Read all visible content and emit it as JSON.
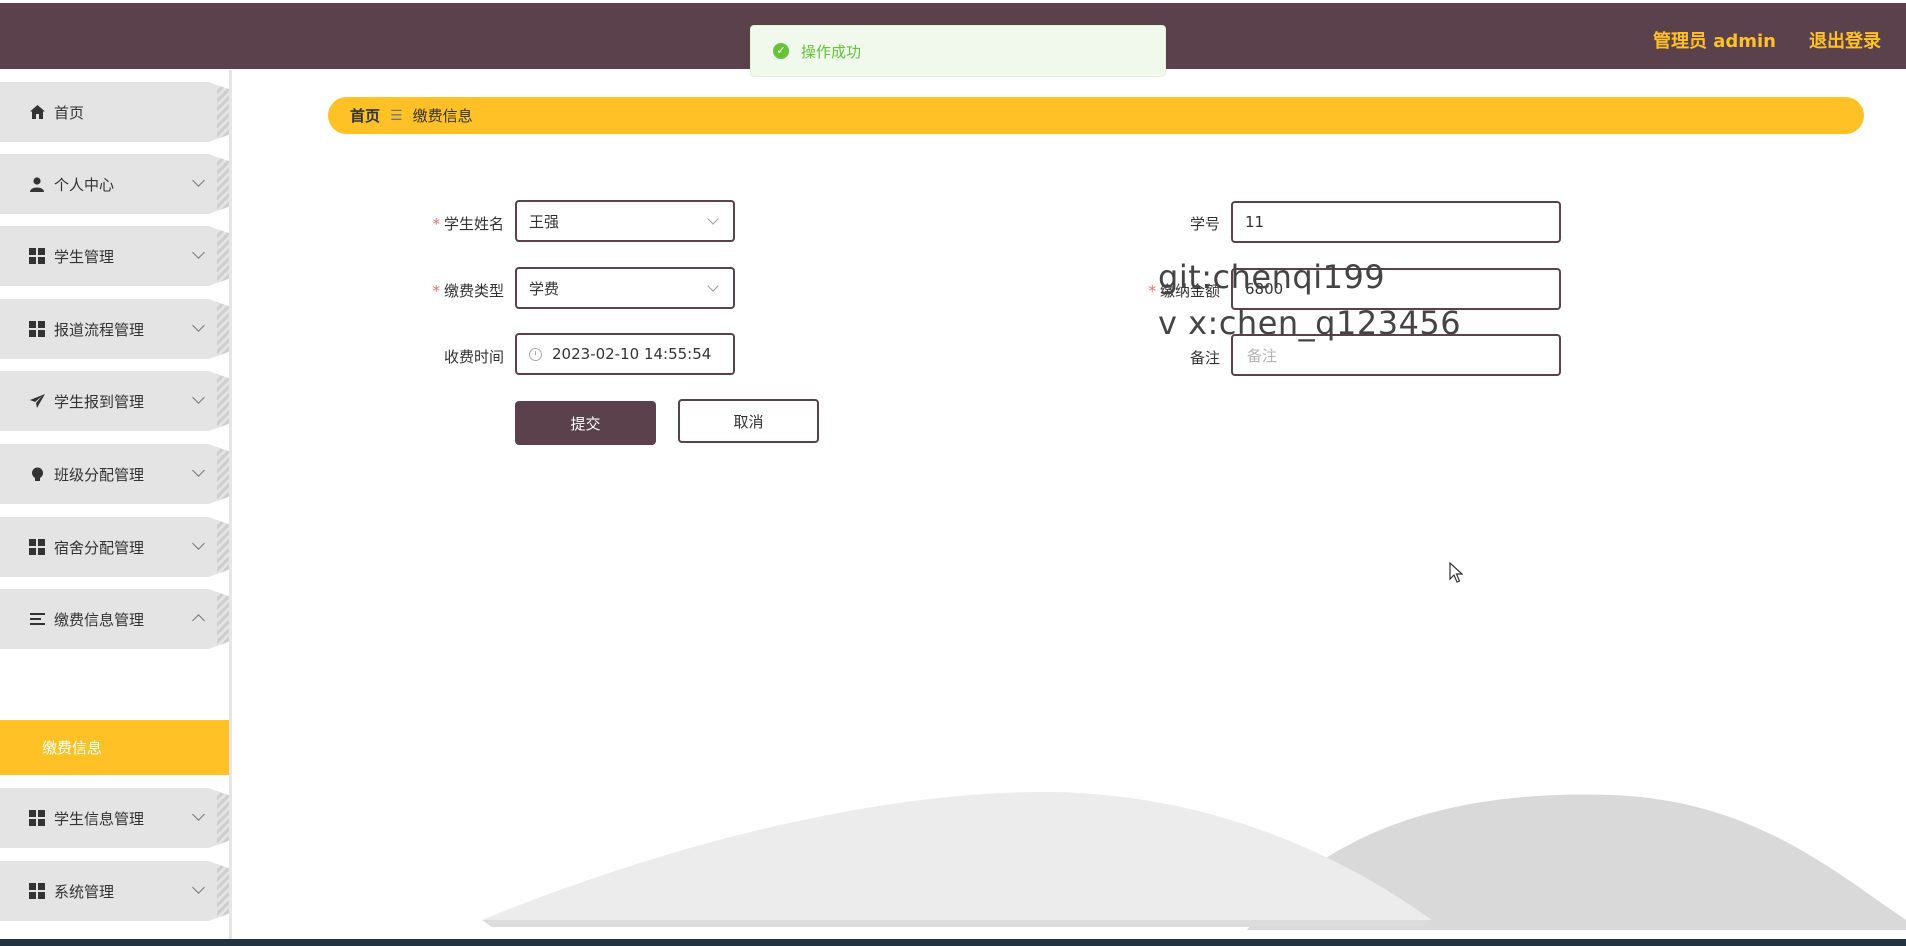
{
  "header": {
    "user_label": "管理员 admin",
    "logout_label": "退出登录"
  },
  "toast": {
    "message": "操作成功",
    "icon": "check-circle-icon"
  },
  "sidebar": {
    "items": [
      {
        "label": "首页",
        "icon": "home-icon"
      },
      {
        "label": "个人中心",
        "icon": "user-icon"
      },
      {
        "label": "学生管理",
        "icon": "grid-icon"
      },
      {
        "label": "报道流程管理",
        "icon": "grid-icon"
      },
      {
        "label": "学生报到管理",
        "icon": "send-icon"
      },
      {
        "label": "班级分配管理",
        "icon": "bulb-icon"
      },
      {
        "label": "宿舍分配管理",
        "icon": "grid-icon"
      },
      {
        "label": "缴费信息管理",
        "icon": "list-icon"
      },
      {
        "label": "学生信息管理",
        "icon": "grid-icon"
      },
      {
        "label": "系统管理",
        "icon": "grid-icon"
      }
    ],
    "active_sub": "缴费信息"
  },
  "breadcrumb": {
    "home": "首页",
    "separator": "☰",
    "current": "缴费信息"
  },
  "form": {
    "student_name": {
      "label": "学生姓名",
      "value": "王强"
    },
    "student_no": {
      "label": "学号",
      "value": "11"
    },
    "fee_type": {
      "label": "缴费类型",
      "value": "学费"
    },
    "amount": {
      "label": "缴纳金额",
      "value": "6800"
    },
    "collect_time": {
      "label": "收费时间",
      "value": "2023-02-10 14:55:54"
    },
    "remark": {
      "label": "备注",
      "placeholder": "备注"
    },
    "submit_label": "提交",
    "cancel_label": "取消"
  },
  "watermark": {
    "line1": "git:chenqi199",
    "line2": "v x:chen_q123456"
  },
  "colors": {
    "primary": "#5a414b",
    "accent": "#ffc125",
    "success": "#67c23a"
  }
}
